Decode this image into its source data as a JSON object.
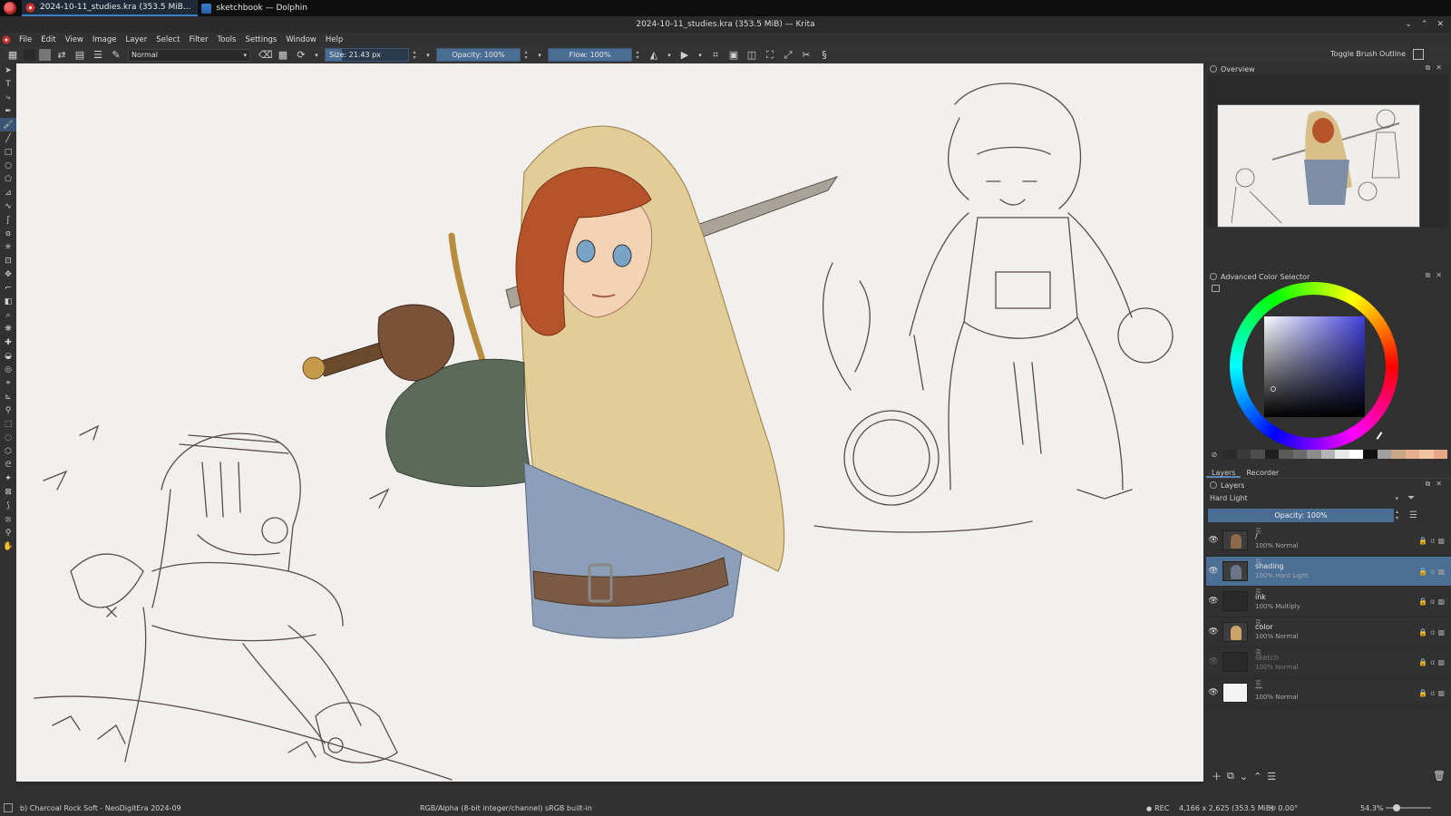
{
  "taskbar": {
    "tasks": [
      {
        "label": "2024-10-11_studies.kra (353.5 MiB..."
      },
      {
        "label": "sketchbook — Dolphin"
      }
    ]
  },
  "window": {
    "title": "2024-10-11_studies.kra (353.5 MiB) — Krita"
  },
  "menu": [
    "File",
    "Edit",
    "View",
    "Image",
    "Layer",
    "Select",
    "Filter",
    "Tools",
    "Settings",
    "Window",
    "Help"
  ],
  "tool_options": {
    "blend_mode": "Normal",
    "size": "Size: 21.43 px",
    "size_fraction": 0.2,
    "opacity": "Opacity: 100%",
    "flow": "Flow: 100%",
    "toggle_brush_outline": "Toggle Brush Outline",
    "fg_color": "#2a2a2a",
    "bg_color": "#777777"
  },
  "dockers": {
    "overview_title": "Overview",
    "color_selector_title": "Advanced Color Selector",
    "tabs": [
      "Layers",
      "Recorder"
    ],
    "layers_title": "Layers",
    "layer_blend": "Hard Light",
    "layer_opacity": "Opacity: 100%",
    "palette": [
      "#2b2b2b",
      "#3a3a3a",
      "#4d4d4d",
      "#1f1f1f",
      "#5a5a5a",
      "#6b6b6b",
      "#8c8c8c",
      "#b5b5b5",
      "#e8e8e8",
      "#ffffff",
      "#111111",
      "#a0a0a0",
      "#c9a88a",
      "#e6b08e",
      "#f0c3a3",
      "#e7a888"
    ]
  },
  "layers": [
    {
      "name": "/",
      "mode": "100% Normal",
      "visible": true,
      "selected": false,
      "thumb": "group"
    },
    {
      "name": "shading",
      "mode": "100% Hard Light",
      "visible": true,
      "selected": true,
      "thumb": "figure"
    },
    {
      "name": "ink",
      "mode": "100% Multiply",
      "visible": true,
      "selected": false,
      "thumb": "dark"
    },
    {
      "name": "color",
      "mode": "100% Normal",
      "visible": true,
      "selected": false,
      "thumb": "color"
    },
    {
      "name": "sketch",
      "mode": "100% Normal",
      "visible": false,
      "selected": false,
      "thumb": "dark"
    },
    {
      "name": "—",
      "mode": "100% Normal",
      "visible": true,
      "selected": false,
      "thumb": "white"
    }
  ],
  "status": {
    "brush": "b) Charcoal Rock Soft - NeoDigitEra 2024-09",
    "profile": "RGB/Alpha (8-bit integer/channel)  sRGB built-in",
    "rec": "REC",
    "dimensions": "4,166 x 2,625 (353.5 MiB)",
    "rotation": "0.00°",
    "zoom": "54.3%"
  }
}
